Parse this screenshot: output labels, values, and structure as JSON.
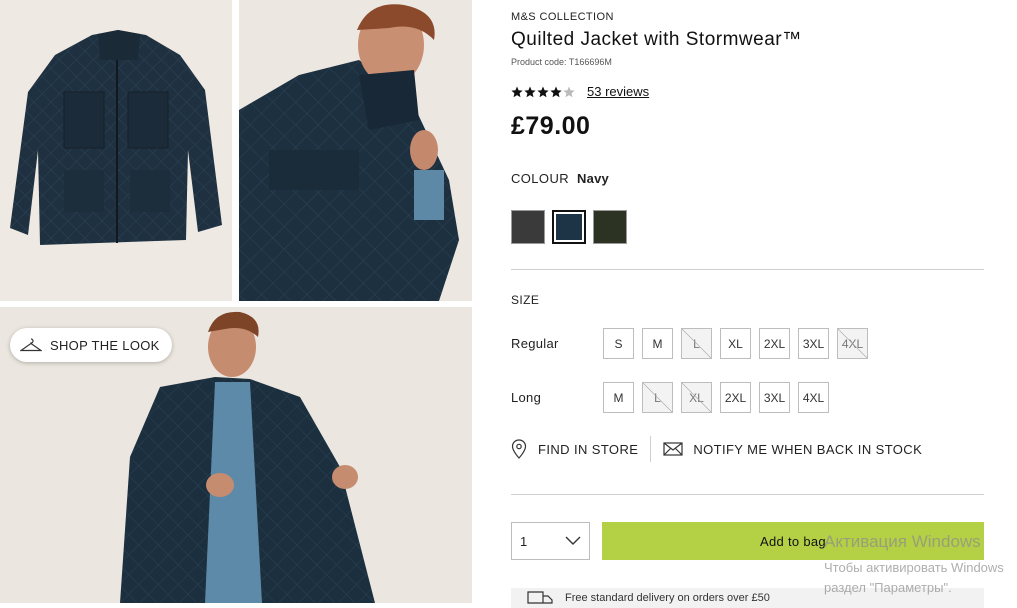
{
  "gallery": {
    "shop_the_look": "SHOP THE LOOK"
  },
  "product": {
    "brand": "M&S COLLECTION",
    "title": "Quilted Jacket with Stormwear™",
    "code": "Product code: T166696M",
    "rating": 4,
    "rating_max": 5,
    "reviews": "53 reviews",
    "price": "£79.00"
  },
  "colour": {
    "label": "COLOUR",
    "selected": "Navy",
    "swatches": [
      {
        "name": "charcoal",
        "color": "#3a3a3a",
        "selected": false
      },
      {
        "name": "navy",
        "color": "#1d3446",
        "selected": true
      },
      {
        "name": "khaki",
        "color": "#2c3322",
        "selected": false
      }
    ]
  },
  "size": {
    "label": "SIZE",
    "rows": [
      {
        "label": "Regular",
        "sizes": [
          {
            "label": "S",
            "available": true
          },
          {
            "label": "M",
            "available": true
          },
          {
            "label": "L",
            "available": false
          },
          {
            "label": "XL",
            "available": true
          },
          {
            "label": "2XL",
            "available": true
          },
          {
            "label": "3XL",
            "available": true
          },
          {
            "label": "4XL",
            "available": false
          }
        ]
      },
      {
        "label": "Long",
        "sizes": [
          {
            "label": "M",
            "available": true
          },
          {
            "label": "L",
            "available": false
          },
          {
            "label": "XL",
            "available": false
          },
          {
            "label": "2XL",
            "available": true
          },
          {
            "label": "3XL",
            "available": true
          },
          {
            "label": "4XL",
            "available": true
          }
        ]
      }
    ]
  },
  "store": {
    "find": "FIND IN STORE",
    "notify": "NOTIFY ME WHEN BACK IN STOCK"
  },
  "purchase": {
    "quantity": "1",
    "add_to_bag": "Add to bag",
    "accent_color": "#b4d146"
  },
  "delivery": {
    "text": "Free standard delivery on orders over £50"
  },
  "watermark": {
    "line1": "Активация Windows",
    "line2": "Чтобы активировать Windows",
    "line3": "раздел \"Параметры\"."
  }
}
